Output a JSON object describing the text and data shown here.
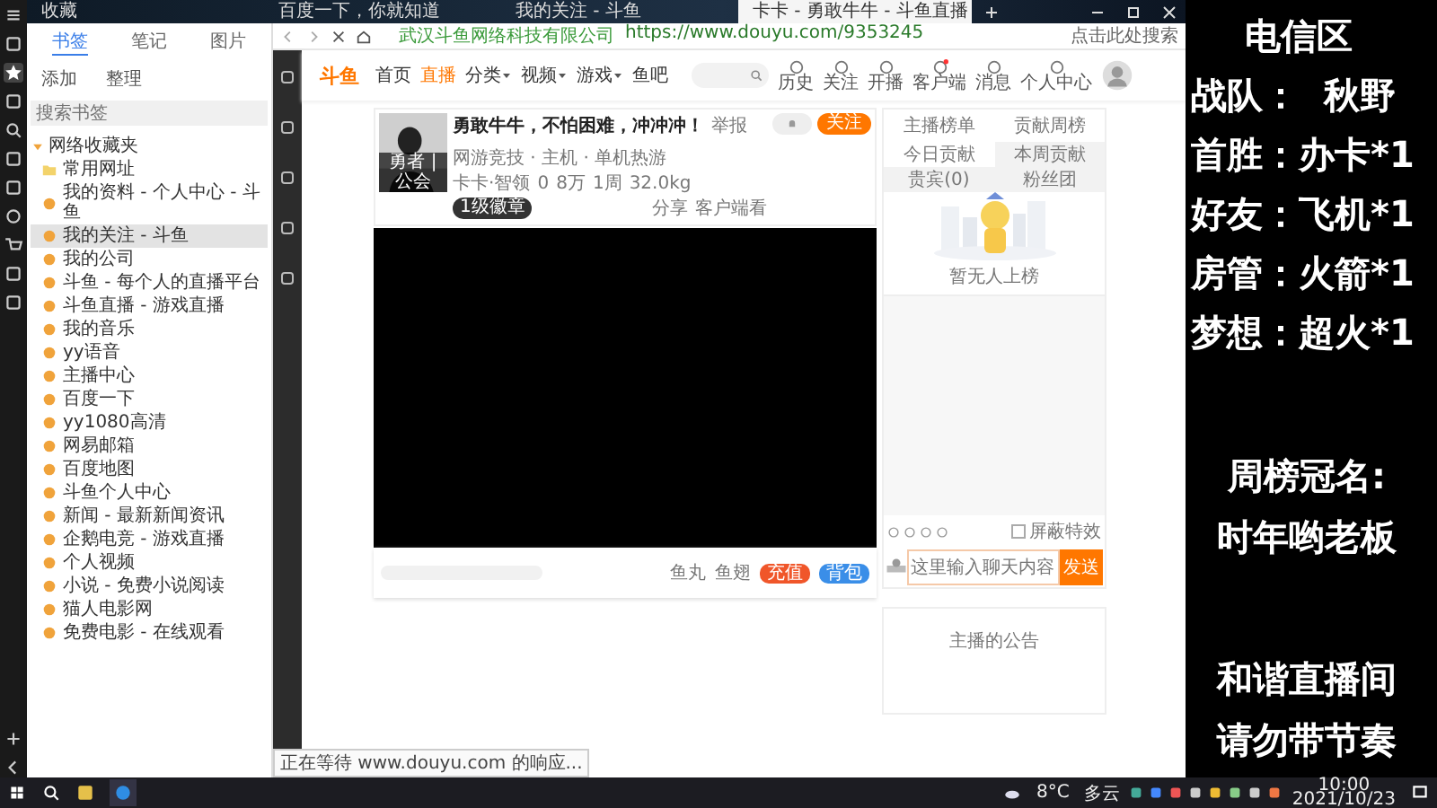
{
  "browser_tabs": [
    {
      "title": "收藏",
      "selected": false
    },
    {
      "title": "百度一下，你就知道",
      "selected": false
    },
    {
      "title": "我的关注 - 斗鱼",
      "selected": false
    },
    {
      "title": "卡卡 - 勇敢牛牛 - 斗鱼直播",
      "selected": true
    }
  ],
  "bookmarks": {
    "tabs": [
      {
        "label": "书签",
        "selected": true
      },
      {
        "label": "笔记",
        "selected": false
      },
      {
        "label": "图片",
        "selected": false
      }
    ],
    "actions": [
      "添加",
      "整理"
    ],
    "search": {
      "placeholder": "搜索书签"
    },
    "tree": {
      "label": "网络收藏夹",
      "expanded": true,
      "children": [
        {
          "label": "常用网址",
          "kind": "folder",
          "selected": false
        },
        {
          "label": "我的资料 - 个人中心 - 斗鱼",
          "kind": "page",
          "selected": false
        },
        {
          "label": "我的关注 - 斗鱼",
          "kind": "page",
          "selected": true
        },
        {
          "label": "我的公司",
          "kind": "page",
          "selected": false
        },
        {
          "label": "斗鱼 - 每个人的直播平台",
          "kind": "page",
          "selected": false
        },
        {
          "label": "斗鱼直播 - 游戏直播",
          "kind": "page",
          "selected": false
        },
        {
          "label": "我的音乐",
          "kind": "page",
          "selected": false
        },
        {
          "label": "yy语音",
          "kind": "page",
          "selected": false
        },
        {
          "label": "主播中心",
          "kind": "page",
          "selected": false
        },
        {
          "label": "百度一下",
          "kind": "page",
          "selected": false
        },
        {
          "label": "yy1080高清",
          "kind": "page",
          "selected": false
        },
        {
          "label": "网易邮箱",
          "kind": "page",
          "selected": false
        },
        {
          "label": "百度地图",
          "kind": "page",
          "selected": false
        },
        {
          "label": "斗鱼个人中心",
          "kind": "page",
          "selected": false
        },
        {
          "label": "新闻 - 最新新闻资讯",
          "kind": "page",
          "selected": false
        },
        {
          "label": "企鹅电竞 - 游戏直播",
          "kind": "page",
          "selected": false
        },
        {
          "label": "个人视频",
          "kind": "page",
          "selected": false
        },
        {
          "label": "小说 - 免费小说阅读",
          "kind": "page",
          "selected": false
        },
        {
          "label": "猫人电影网",
          "kind": "page",
          "selected": false
        },
        {
          "label": "免费电影 - 在线观看",
          "kind": "page",
          "selected": false
        }
      ]
    }
  },
  "address_bar": {
    "company": "武汉斗鱼网络科技有限公司",
    "url": "https://www.douyu.com/9353245",
    "search_placeholder": "点击此处搜索"
  },
  "site_nav": {
    "logo": "斗鱼",
    "items": [
      {
        "label": "首页",
        "selected": false,
        "dropdown": false
      },
      {
        "label": "直播",
        "selected": true,
        "dropdown": false
      },
      {
        "label": "分类",
        "selected": false,
        "dropdown": true
      },
      {
        "label": "视频",
        "selected": false,
        "dropdown": true
      },
      {
        "label": "游戏",
        "selected": false,
        "dropdown": true
      },
      {
        "label": "鱼吧",
        "selected": false,
        "dropdown": false
      }
    ],
    "tools": [
      {
        "label": "历史",
        "badge": false
      },
      {
        "label": "关注",
        "badge": false
      },
      {
        "label": "开播",
        "badge": false
      },
      {
        "label": "客户端",
        "badge": true
      },
      {
        "label": "消息",
        "badge": false
      },
      {
        "label": "个人中心",
        "badge": false
      }
    ]
  },
  "room": {
    "title": "勇敢牛牛，不怕困难，冲冲冲！",
    "report": "举报",
    "category": "网游竞技 · 主机 · 单机热游",
    "streamer": "卡卡·智领",
    "avatar_caption": "勇者 | 公会",
    "stats": [
      "0",
      "8万",
      "1周",
      "32.0kg"
    ],
    "badge": "1级徽章",
    "follow": "关注",
    "share": "分享",
    "client": "客户端看"
  },
  "gift_bar": {
    "items": [
      "鱼丸",
      "鱼翅"
    ],
    "recharge": "充值",
    "backpack": "背包"
  },
  "side_panel": {
    "links": [
      "主播榜单",
      "贡献周榜"
    ],
    "tabs": [
      {
        "label": "今日贡献",
        "selected": true
      },
      {
        "label": "本周贡献",
        "selected": false
      },
      {
        "label": "贵宾(0)",
        "selected": false
      },
      {
        "label": "粉丝团",
        "selected": false
      }
    ],
    "empty_text": "暂无人上榜",
    "mute_effects": {
      "label": "屏蔽特效",
      "checked": false
    },
    "chat_placeholder": "这里输入聊天内容",
    "send": "发送",
    "notice_title": "主播的公告"
  },
  "status_bar": "正在等待 www.douyu.com 的响应...",
  "overlay": [
    [
      "电信区",
      "战队：  秋野",
      "首胜：办卡*1",
      "好友：飞机*1",
      "房管：火箭*1",
      "梦想：超火*1"
    ],
    [
      "周榜冠名:",
      "时年哟老板"
    ],
    [
      "和谐直播间",
      "请勿带节奏"
    ]
  ],
  "taskbar": {
    "temperature": "8°C",
    "weather": "多云",
    "time": "10:00",
    "date": "2021/10/23"
  }
}
